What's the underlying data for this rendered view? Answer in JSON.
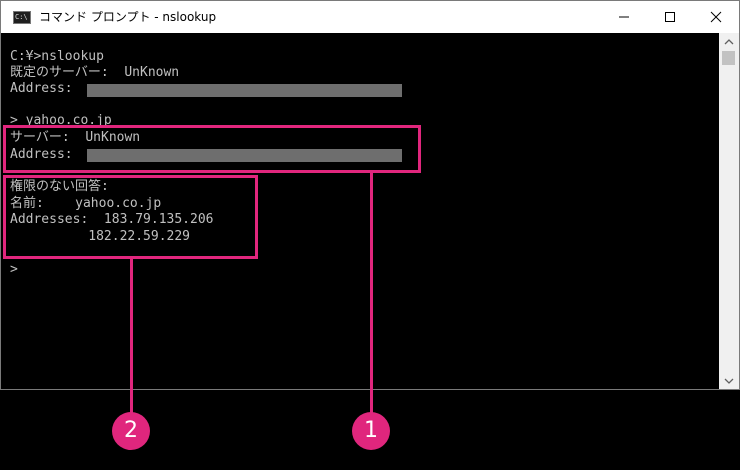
{
  "window": {
    "title": "コマンド プロンプト - nslookup",
    "icon_text": "C:\\",
    "controls": [
      "minimize-icon",
      "maximize-icon",
      "close-icon"
    ]
  },
  "console": {
    "lines": [
      "C:¥>nslookup",
      "既定のサーバー:  UnKnown",
      "Address:",
      "> yahoo.co.jp",
      "サーバー:  UnKnown",
      "Address:",
      "権限のない回答:",
      "名前:    yahoo.co.jp",
      "Addresses:  183.79.135.206",
      "          182.22.59.229",
      ">"
    ]
  },
  "scrollbar": {
    "up_icon": "triangle-up-icon",
    "down_icon": "triangle-down-icon"
  },
  "annotations": {
    "marker_1": "1",
    "marker_2": "2",
    "color": "#e0267d"
  }
}
